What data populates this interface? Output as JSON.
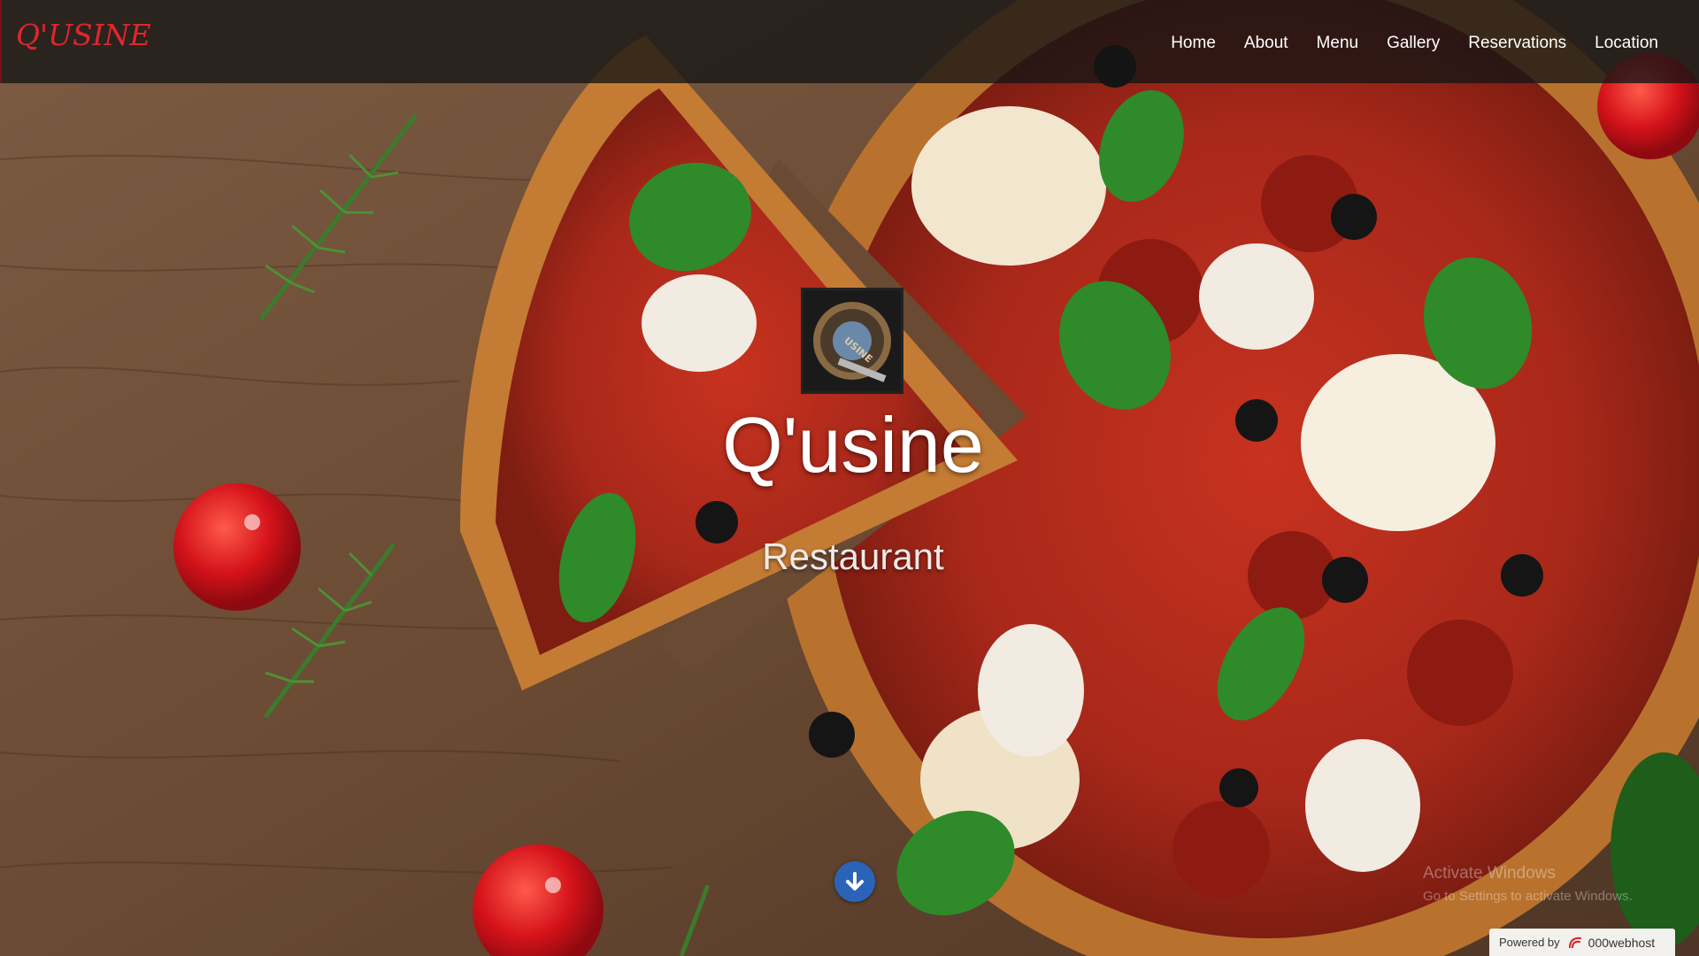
{
  "navbar": {
    "brand": "Q'USINE",
    "items": [
      {
        "label": "Home"
      },
      {
        "label": "About"
      },
      {
        "label": "Menu"
      },
      {
        "label": "Gallery"
      },
      {
        "label": "Reservations"
      },
      {
        "label": "Location"
      }
    ]
  },
  "hero": {
    "logo_text": "USINE",
    "title": "Q'usine",
    "subtitle": "Restaurant",
    "scroll_icon": "arrow-down-circle-icon"
  },
  "watermark": {
    "title": "Activate Windows",
    "subtitle": "Go to Settings to activate Windows."
  },
  "footer_badge": {
    "label": "Powered by",
    "host": "000webhost"
  },
  "colors": {
    "brand_red": "#e0262c",
    "nav_bg": "#141414",
    "scroll_button": "#2b63b8"
  }
}
